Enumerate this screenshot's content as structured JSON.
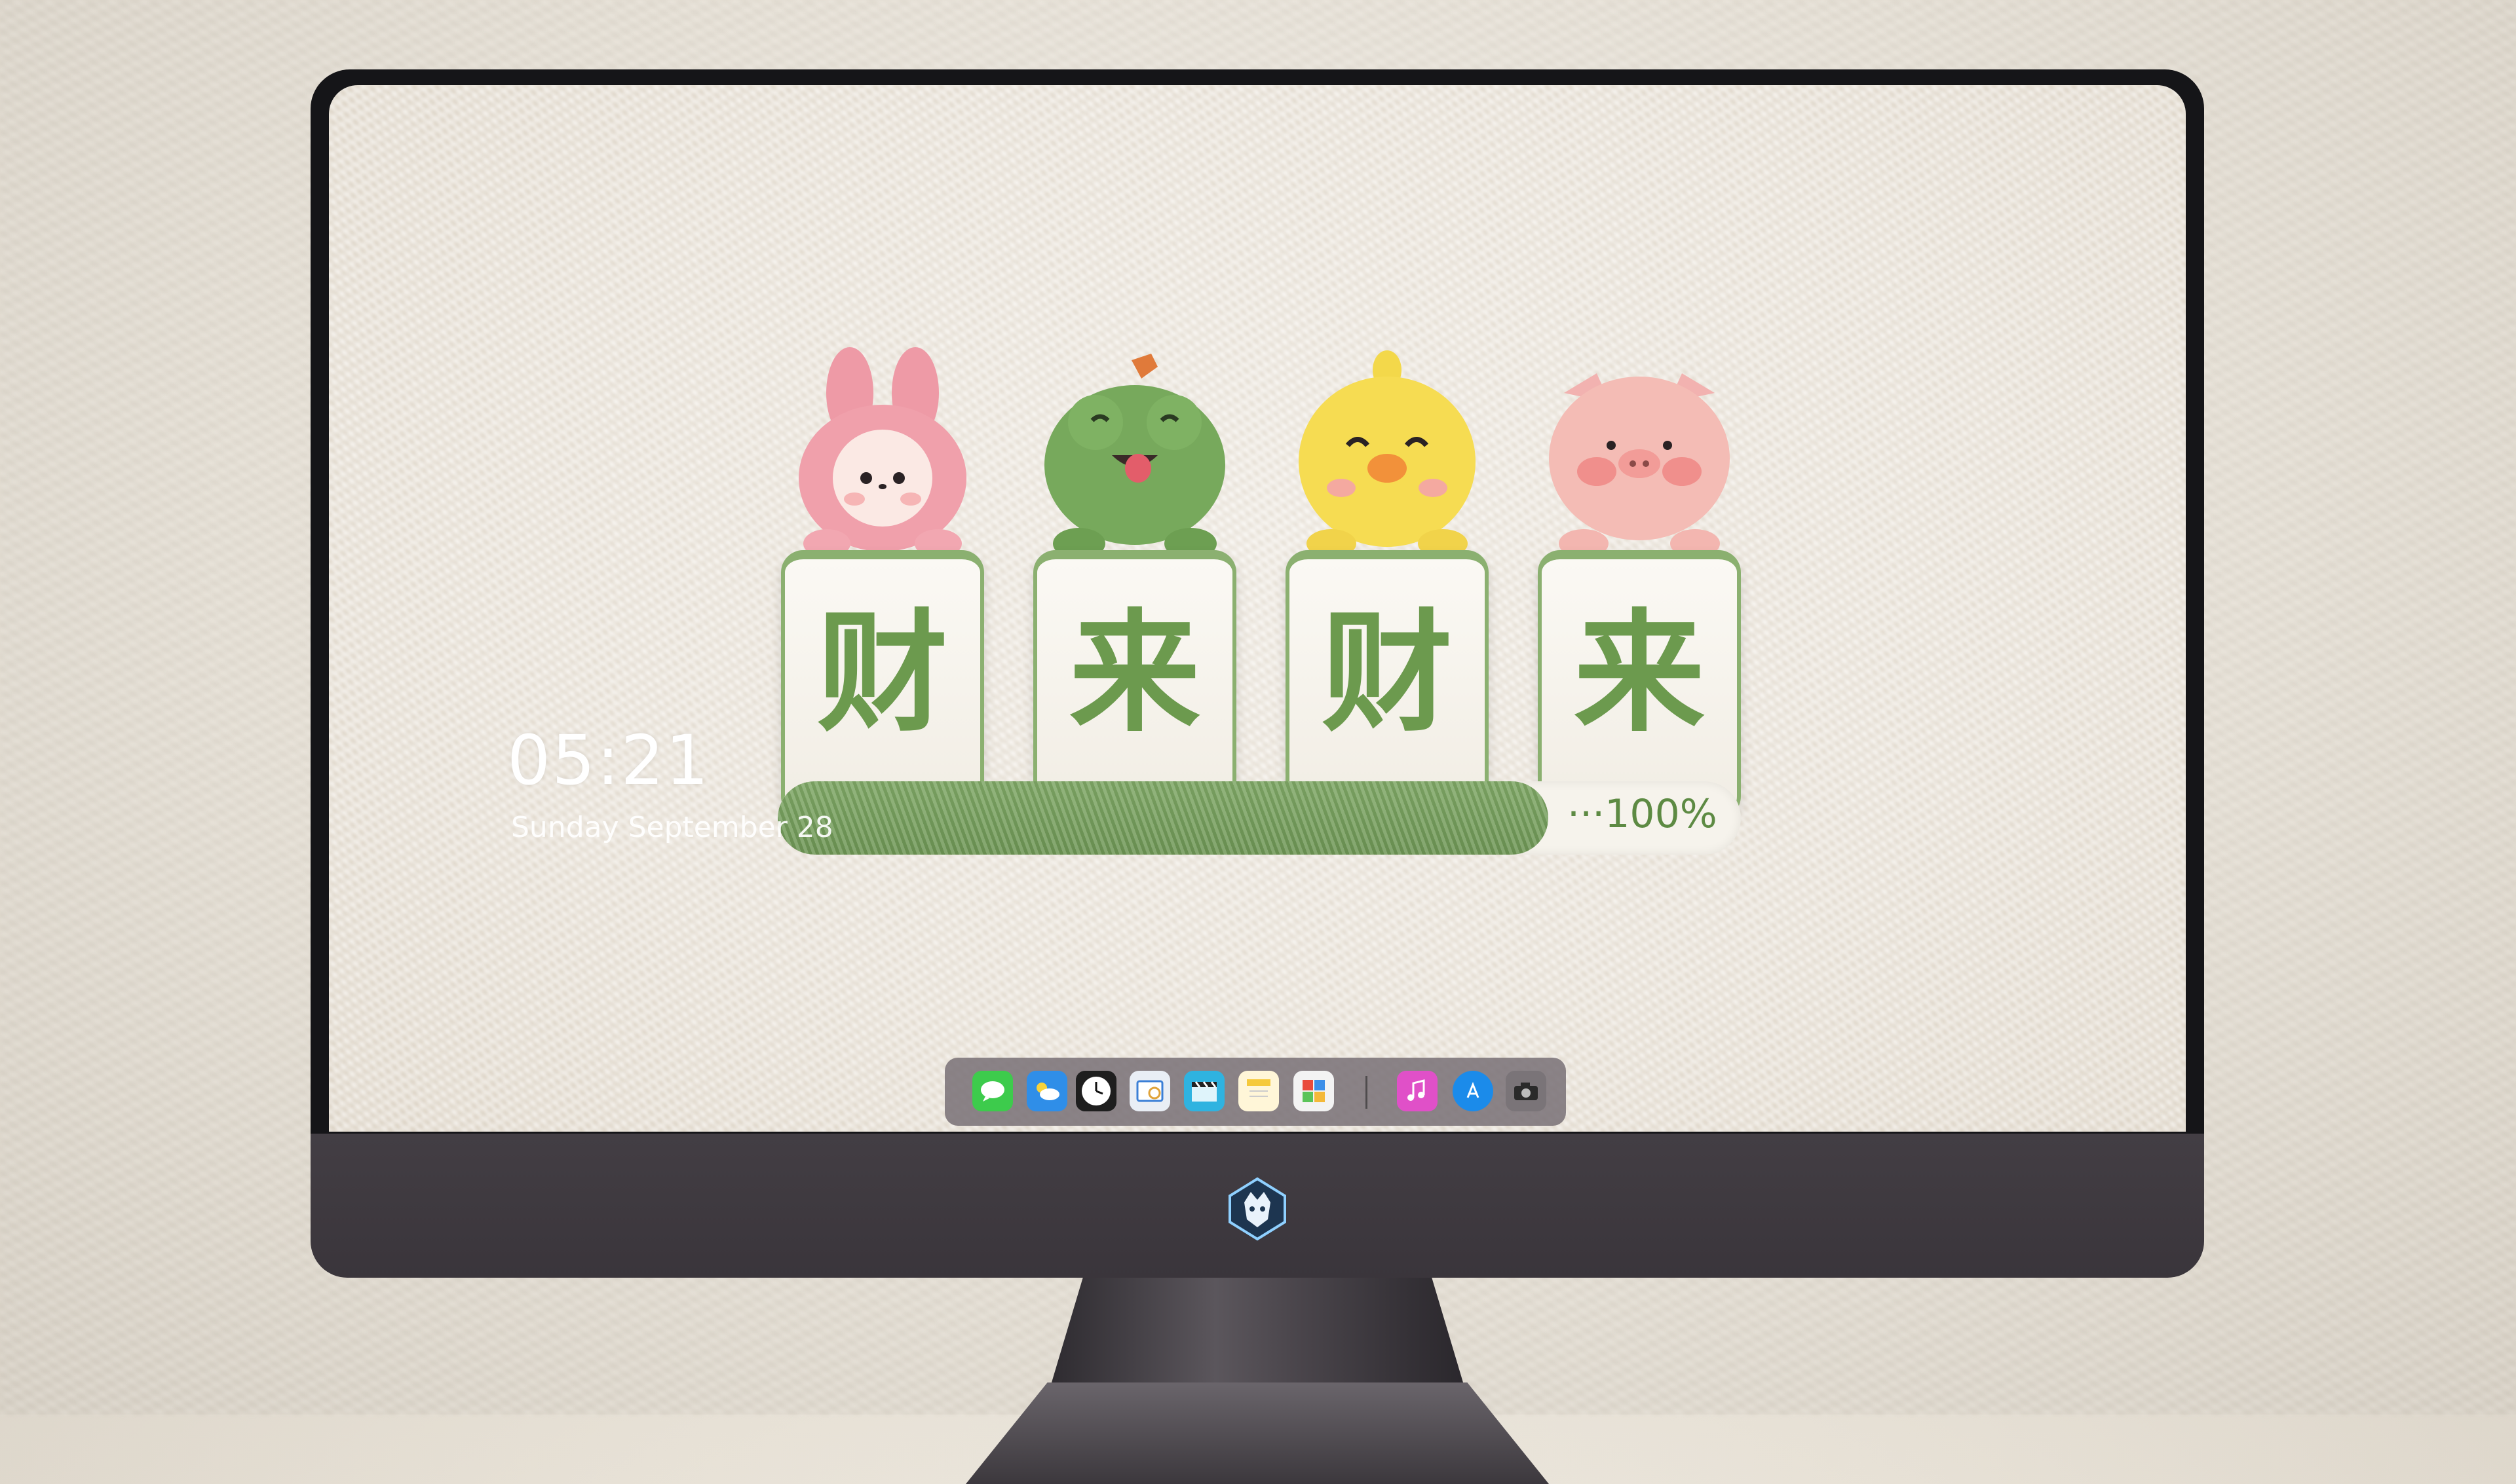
{
  "lock_screen": {
    "time": "05:21",
    "date": "Sunday September  28"
  },
  "mahjong_tiles": [
    {
      "character": "财",
      "mascot": "pink-bunny"
    },
    {
      "character": "来",
      "mascot": "green-frog"
    },
    {
      "character": "财",
      "mascot": "yellow-chick"
    },
    {
      "character": "来",
      "mascot": "pink-pig"
    }
  ],
  "progress": {
    "label": "···100%",
    "value": 0.8
  },
  "dock": {
    "icons": [
      "messages-icon",
      "weather-icon",
      "clock-icon",
      "preview-icon",
      "clapper-icon",
      "notes-icon",
      "photos-icon",
      "music-icon",
      "app-store-icon",
      "camera-icon"
    ]
  },
  "colors": {
    "tile_green": "#6c9a4e",
    "progress_green": "#7fa866",
    "bezel": "#151518",
    "chin": "#433e44"
  }
}
